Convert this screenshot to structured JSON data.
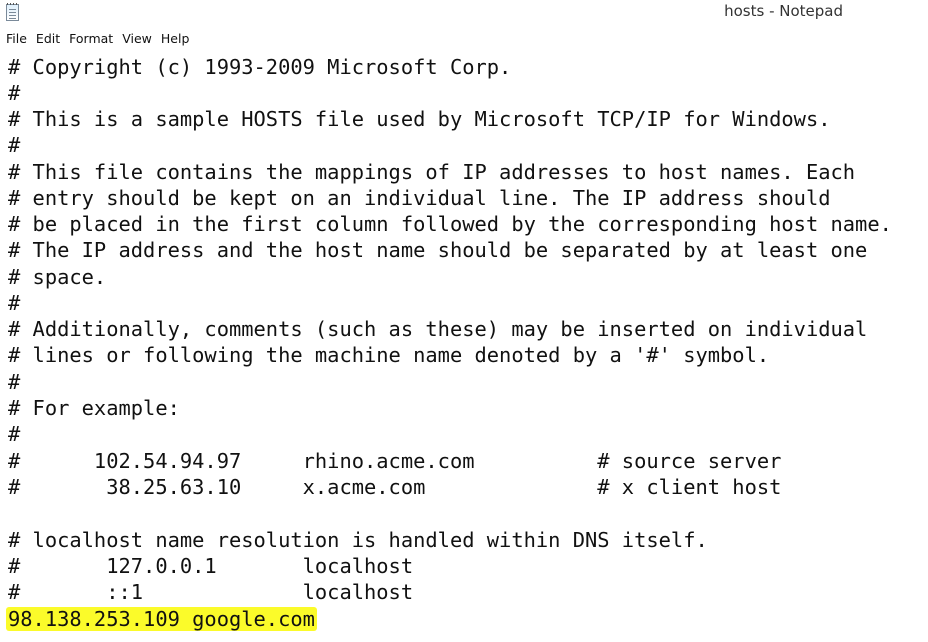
{
  "window": {
    "title": "hosts - Notepad"
  },
  "menu": {
    "items": [
      "File",
      "Edit",
      "Format",
      "View",
      "Help"
    ]
  },
  "editor": {
    "lines": [
      "# Copyright (c) 1993-2009 Microsoft Corp.",
      "#",
      "# This is a sample HOSTS file used by Microsoft TCP/IP for Windows.",
      "#",
      "# This file contains the mappings of IP addresses to host names. Each",
      "# entry should be kept on an individual line. The IP address should",
      "# be placed in the first column followed by the corresponding host name.",
      "# The IP address and the host name should be separated by at least one",
      "# space.",
      "#",
      "# Additionally, comments (such as these) may be inserted on individual",
      "# lines or following the machine name denoted by a '#' symbol.",
      "#",
      "# For example:",
      "#",
      "#      102.54.94.97     rhino.acme.com          # source server",
      "#       38.25.63.10     x.acme.com              # x client host",
      "",
      "# localhost name resolution is handled within DNS itself.",
      "#       127.0.0.1       localhost",
      "#       ::1             localhost",
      "98.138.253.109 google.com"
    ],
    "highlighted_line": "98.138.253.109 google.com",
    "highlight_color": "#fbfb2a"
  }
}
